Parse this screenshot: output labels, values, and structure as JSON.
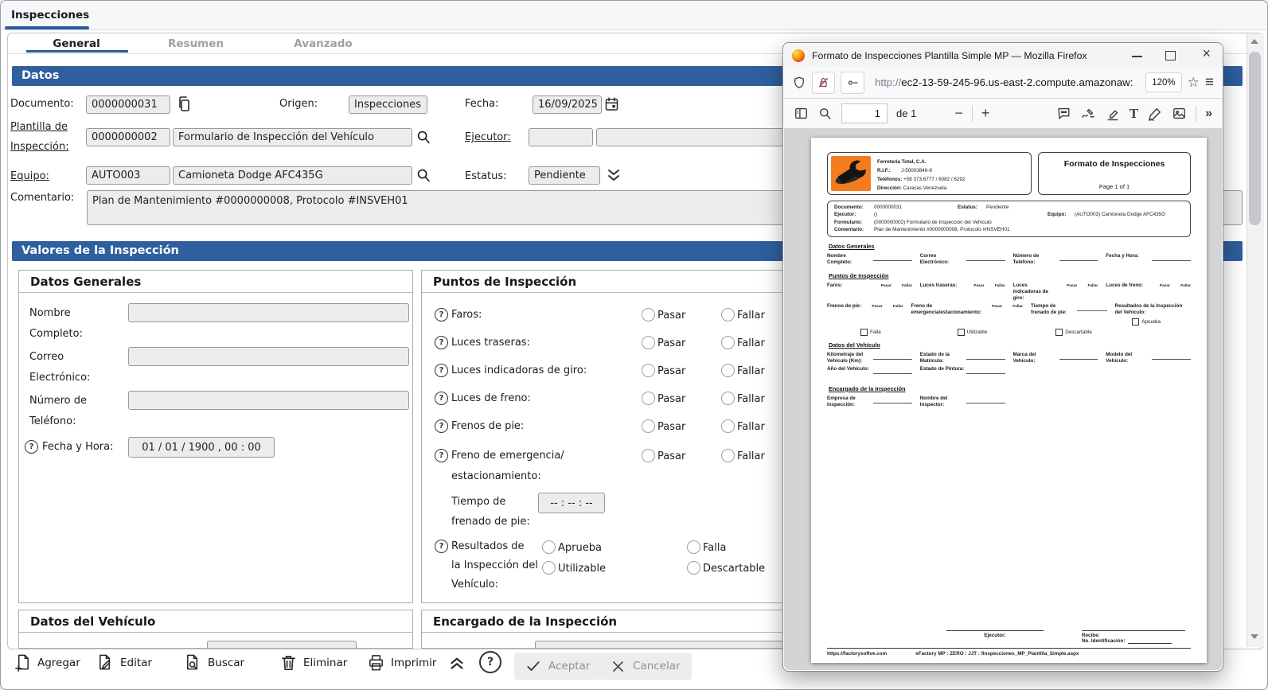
{
  "app": {
    "tab": "Inspecciones",
    "subtabs": [
      "General",
      "Resumen",
      "Avanzado"
    ],
    "datos": {
      "header": "Datos",
      "documento_label": "Documento:",
      "documento_value": "0000000031",
      "origen_label": "Origen:",
      "origen_value": "Inspecciones",
      "fecha_label": "Fecha:",
      "fecha_value": "16/09/2025",
      "plantilla_label_1": "Plantilla de",
      "plantilla_label_2": "Inspección:",
      "plantilla_code": "0000000002",
      "plantilla_name": "Formulario de Inspección del Vehículo",
      "ejecutor_label": "Ejecutor:",
      "equipo_label": "Equipo:",
      "equipo_code": "AUTO003",
      "equipo_name": "Camioneta Dodge AFC435G",
      "estatus_label": "Estatus:",
      "estatus_value": "Pendiente",
      "comentario_label": "Comentario:",
      "comentario_value": "Plan de Mantenimiento #0000000008, Protocolo #INSVEH01"
    },
    "valores": {
      "header": "Valores de la Inspección",
      "datos_generales": {
        "title": "Datos Generales",
        "nombre_1": "Nombre",
        "nombre_2": "Completo:",
        "correo_1": "Correo",
        "correo_2": "Electrónico:",
        "telefono_1": "Número de",
        "telefono_2": "Teléfono:",
        "fecha_hora_label": "Fecha y Hora:",
        "fecha_hora_value": "01 / 01 / 1900 ,  00 : 00"
      },
      "puntos": {
        "title": "Puntos de Inspección",
        "pasar": "Pasar",
        "fallar": "Fallar",
        "items": [
          "Faros:",
          "Luces traseras:",
          "Luces indicadoras de giro:",
          "Luces de freno:",
          "Frenos de pie:"
        ],
        "freno_emergencia_1": "Freno de emergencia/",
        "freno_emergencia_2": "estacionamiento:",
        "tiempo_1": "Tiempo de",
        "tiempo_2": "frenado de pie:",
        "tiempo_value": "-- : -- : --",
        "resultados_1": "Resultados de",
        "resultados_2": "la Inspección del",
        "resultados_3": "Vehículo:",
        "aprueba": "Aprueba",
        "falla": "Falla",
        "utilizable": "Utilizable",
        "descartable": "Descartable"
      },
      "datos_vehiculo_title": "Datos del Vehículo",
      "encargado_title": "Encargado de la Inspección"
    },
    "toolbar": {
      "agregar": "Agregar",
      "editar": "Editar",
      "buscar": "Buscar",
      "eliminar": "Eliminar",
      "imprimir": "Imprimir",
      "aceptar": "Aceptar",
      "cancelar": "Cancelar"
    }
  },
  "icons": {
    "minus": "−",
    "plus": "+",
    "chevrons_right": "»",
    "hamburger": "≡",
    "star": "☆",
    "close": "×",
    "help": "?",
    "text_tool": "T"
  },
  "firefox": {
    "title": "Formato de Inspecciones Plantilla Simple MP — Mozilla Firefox",
    "url_scheme": "http://",
    "url_host": "ec2-13-59-245-96.us-east-2.compute.amazonaw:",
    "zoom": "120%",
    "page_value": "1",
    "page_of": "de 1"
  },
  "pdf": {
    "company_name": "Ferretería Total, C.A.",
    "rif_label": "R.I.F.:",
    "rif_value": "J-50003846-9",
    "phones_label": "Teléfonos:",
    "phones_value": "+58 373.6777 / 6082 / 6292",
    "address_label": "Dirección:",
    "address_value": "Caracas Venezuela",
    "doc_title": "Formato de Inspecciones",
    "page_label": "Page 1 of 1",
    "info": {
      "documento_label": "Documento:",
      "documento": "0000000031",
      "estatus_label": "Estatus:",
      "estatus": "Pendiente",
      "ejecutor_label": "Ejecutor:",
      "ejecutor": "()",
      "equipo_label": "Equipo:",
      "equipo": "(AUTO003) Camioneta Dodge AFC435G",
      "formulario_label": "Formulario:",
      "formulario": "(0000000002) Formulario de Inspección del Vehículo",
      "comentario_label": "Comentario:",
      "comentario": "Plan de Mantenimiento #0000000008, Protocolo #INSVEH01"
    },
    "sec_generales_title": "Datos Generales",
    "generales_fields": [
      "Nombre Completo:",
      "Correo Electrónico:",
      "Número de Teléfono:",
      "Fecha y Hora:"
    ],
    "sec_puntos_title": "Puntos de Inspección",
    "pasar": "Pasar",
    "fallar": "Fallar",
    "puntos_row1": [
      "Faros:",
      "Luces traseras:",
      "Luces indicadoras de giro:",
      "Luces de freno:"
    ],
    "puntos_row2": [
      "Frenos de pie:",
      "Freno de emergencia/estacionamiento:"
    ],
    "tiempo_label": "Tiempo de frenado de pie:",
    "resultados_label": "Resultados de la Inspección del Vehículo:",
    "check_aprueba": "Aprueba",
    "checks": [
      "Falla",
      "Utilizable",
      "Descartable"
    ],
    "sec_vehiculo_title": "Datos del Vehículo",
    "vehiculo_row1": [
      "Kilometraje del Vehículo (Km):",
      "Estado de la Matrícula:",
      "Marca del Vehículo:",
      "Modelo del Vehículo:"
    ],
    "vehiculo_row2": [
      "Año del Vehículo:",
      "Estado de Pintura:"
    ],
    "sec_encargado_title": "Encargado de la Inspección",
    "encargado_fields": [
      "Empresa de Inspección:",
      "Nombre del Inspector:"
    ],
    "footer_ejecutor": "Ejecutor:",
    "footer_recibe": "Recibe:",
    "footer_no_id": "No. Identificación:",
    "footer_site": "https://factorysoftve.com",
    "footer_meta": "eFactory MP  :  ZERO  :  JJT  :  finspecciones_MP_Plantilla_Simple.aspx"
  }
}
